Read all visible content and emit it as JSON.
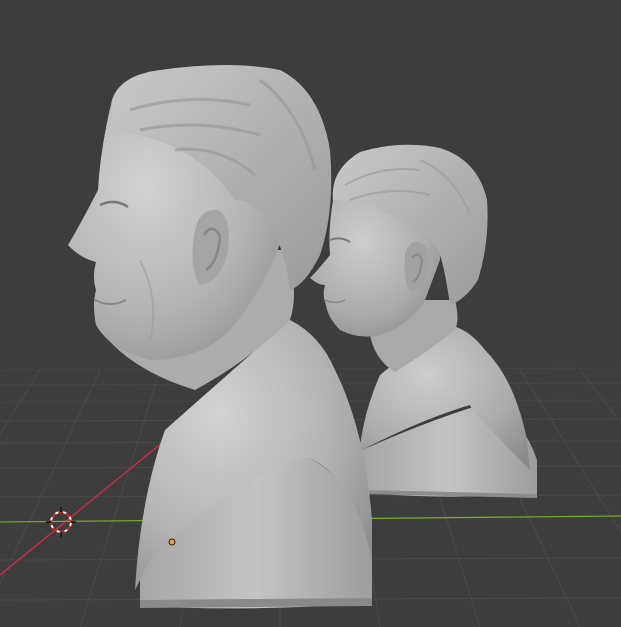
{
  "viewport": {
    "background": "#3d3d3d",
    "grid_color": "#4a4a4a",
    "x_axis_color": "#c0303f",
    "y_axis_color": "#7fb02a",
    "cursor_icon": "3d-cursor-icon",
    "origin_icon": "object-origin-icon",
    "origin_color": "#f0a020",
    "object_color": "#b8b8b8",
    "objects": [
      "bust-sculpt-large",
      "bust-sculpt-small"
    ]
  }
}
